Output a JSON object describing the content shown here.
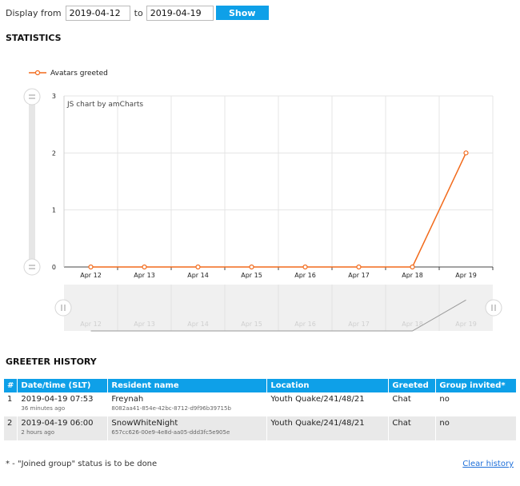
{
  "filter": {
    "label_from": "Display from",
    "date_from": "2019-04-12",
    "label_to": "to",
    "date_to": "2019-04-19",
    "show_button": "Show"
  },
  "statistics": {
    "heading": "STATISTICS",
    "watermark": "JS chart by amCharts"
  },
  "chart_data": {
    "type": "line",
    "categories": [
      "Apr 12",
      "Apr 13",
      "Apr 14",
      "Apr 15",
      "Apr 16",
      "Apr 17",
      "Apr 18",
      "Apr 19"
    ],
    "series": [
      {
        "name": "Avatars greeted",
        "values": [
          0,
          0,
          0,
          0,
          0,
          0,
          0,
          2
        ],
        "color": "#f26a1b"
      }
    ],
    "y_ticks": [
      "0",
      "1",
      "2",
      "3"
    ],
    "ylim": [
      0,
      3
    ],
    "grid": true,
    "legend": "top-left",
    "scrollbar": true
  },
  "history": {
    "heading": "GREETER HISTORY",
    "columns": [
      "#",
      "Date/time (SLT)",
      "Resident name",
      "Location",
      "Greeted",
      "Group invited*"
    ],
    "rows": [
      {
        "num": "1",
        "datetime": "2019-04-19 07:53",
        "ago": "36 minutes ago",
        "name": "Freynah",
        "uuid": "8082aa41-854e-42bc-8712-d9f96b39715b",
        "location": "Youth Quake/241/48/21",
        "greeted": "Chat",
        "group_invited": "no"
      },
      {
        "num": "2",
        "datetime": "2019-04-19 06:00",
        "ago": "2 hours ago",
        "name": "SnowWhiteNight",
        "uuid": "657cc626-00e9-4e8d-aa05-ddd3fc5e905e",
        "location": "Youth Quake/241/48/21",
        "greeted": "Chat",
        "group_invited": "no"
      }
    ],
    "footnote": "* - \"Joined group\" status is to be done",
    "clear_link": "Clear history"
  }
}
